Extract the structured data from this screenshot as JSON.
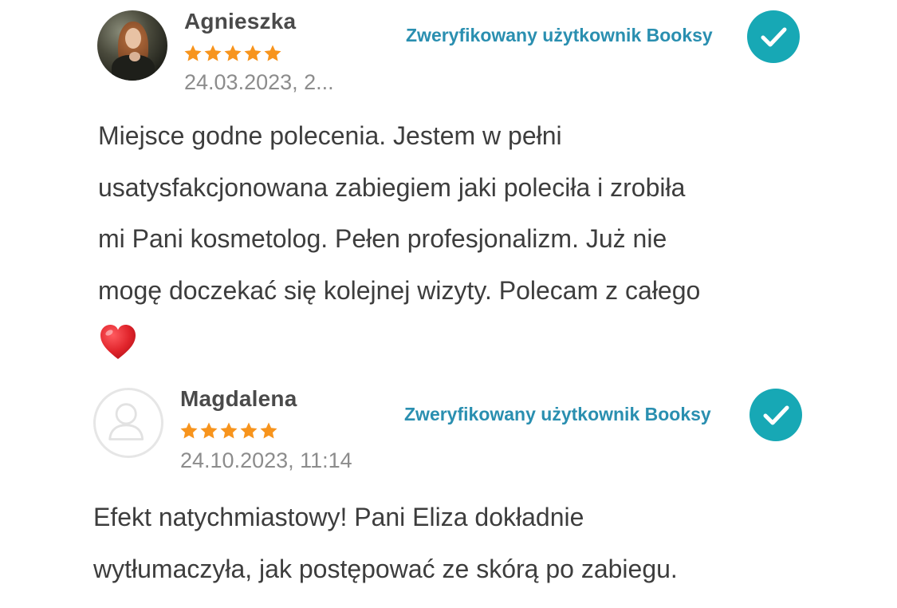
{
  "reviews": [
    {
      "author": "Agnieszka",
      "rating": 5,
      "max_rating": 5,
      "date": "24.03.2023, 2...",
      "verified_label": "Zweryfikowany użytkownik Booksy",
      "avatar": "user-photo",
      "text_lines": [
        "Miejsce godne polecenia. Jestem w pełni",
        "usatysfakcjonowana zabiegiem jaki poleciła i zrobiła",
        "mi Pani kosmetolog. Pełen profesjonalizm. Już nie",
        "mogę doczekać się kolejnej wizyty. Polecam z całego"
      ],
      "emoji": "heart-emoji"
    },
    {
      "author": "Magdalena",
      "rating": 5,
      "max_rating": 5,
      "date": "24.10.2023, 11:14",
      "verified_label": "Zweryfikowany użytkownik Booksy",
      "avatar": "default-user-icon",
      "text_lines": [
        "Efekt natychmiastowy! Pani Eliza dokładnie",
        "wytłumaczyła, jak postępować ze skórą po zabiegu."
      ]
    }
  ],
  "colors": {
    "star": "#f7941d",
    "verified_text": "#2a8fb0",
    "check_badge": "#17a8b5",
    "date_text": "#8c8c8c",
    "body_text": "#3d3d3d",
    "heart": "#e0242b"
  },
  "icons": {
    "star": "star-icon",
    "verified": "check-circle-icon",
    "empty_avatar": "user-outline-icon"
  }
}
